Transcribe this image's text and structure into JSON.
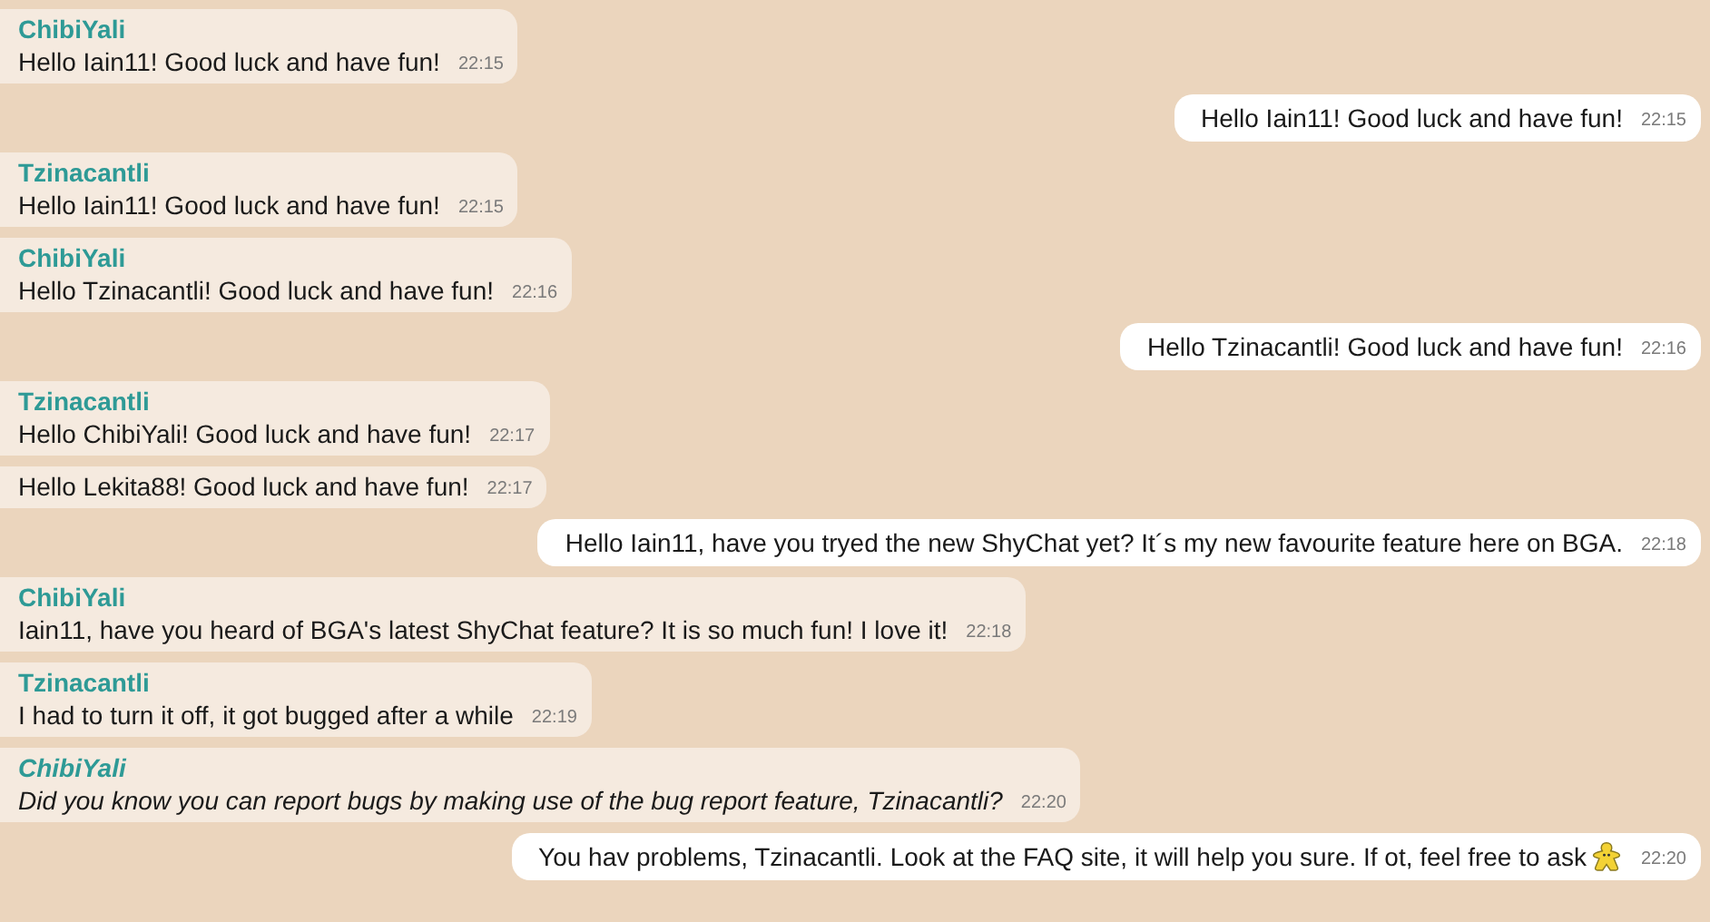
{
  "messages": [
    {
      "kind": "incoming",
      "author": "ChibiYali",
      "text": "Hello Iain11! Good luck and have fun!",
      "time": "22:15",
      "italic": false,
      "emoji": false
    },
    {
      "kind": "outgoing",
      "text": "Hello Iain11! Good luck and have fun!",
      "time": "22:15",
      "italic": false,
      "emoji": false
    },
    {
      "kind": "incoming",
      "author": "Tzinacantli",
      "text": "Hello Iain11! Good luck and have fun!",
      "time": "22:15",
      "italic": false,
      "emoji": false
    },
    {
      "kind": "incoming",
      "author": "ChibiYali",
      "text": "Hello Tzinacantli! Good luck and have fun!",
      "time": "22:16",
      "italic": false,
      "emoji": false
    },
    {
      "kind": "outgoing",
      "text": "Hello Tzinacantli! Good luck and have fun!",
      "time": "22:16",
      "italic": false,
      "emoji": false
    },
    {
      "kind": "incoming",
      "author": "Tzinacantli",
      "text": "Hello ChibiYali! Good luck and have fun!",
      "time": "22:17",
      "italic": false,
      "emoji": false
    },
    {
      "kind": "incoming",
      "text": "Hello Lekita88! Good luck and have fun!",
      "time": "22:17",
      "italic": false,
      "emoji": false
    },
    {
      "kind": "outgoing",
      "text": "Hello Iain11, have you tryed the new ShyChat yet? It´s my new favourite feature here on BGA.",
      "time": "22:18",
      "italic": false,
      "emoji": false
    },
    {
      "kind": "incoming",
      "author": "ChibiYali",
      "text": "Iain11, have you heard of BGA's latest ShyChat feature? It is so much fun! I love it!",
      "time": "22:18",
      "italic": false,
      "emoji": false
    },
    {
      "kind": "incoming",
      "author": "Tzinacantli",
      "text": "I had to turn it off, it got bugged after a while",
      "time": "22:19",
      "italic": false,
      "emoji": false
    },
    {
      "kind": "incoming",
      "author": "ChibiYali",
      "text": "Did you know you can report bugs by making use of the bug report feature, Tzinacantli?",
      "time": "22:20",
      "italic": true,
      "emoji": false
    },
    {
      "kind": "outgoing",
      "text": "You hav problems, Tzinacantli. Look at the FAQ site, it will help you sure. If ot, feel free to ask",
      "time": "22:20",
      "italic": false,
      "emoji": true
    }
  ]
}
